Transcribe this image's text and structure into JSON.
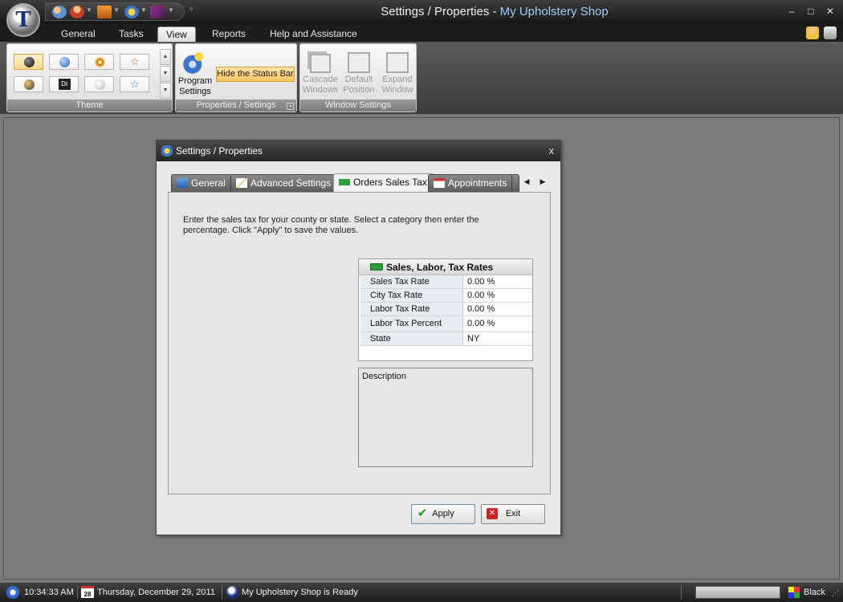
{
  "window": {
    "title": "Settings / Properties",
    "app_name": "My Upholstery Shop",
    "min_label": "–",
    "max_label": "□",
    "close_label": "✕"
  },
  "ribbon_tabs": [
    "General",
    "Tasks",
    "View",
    "Reports",
    "Help and Assistance"
  ],
  "ribbon": {
    "theme_group_label": "Theme",
    "program_settings_label": "Program Settings",
    "hide_status_bar_label": "Hide the Status Bar",
    "properties_group_label": "Properties / Settings",
    "cascade_label": "Cascade Windows",
    "default_position_label": "Default Position",
    "expand_label": "Expand Window",
    "window_group_label": "Window Settings",
    "theme_swatch_dr": "Dr"
  },
  "dialog": {
    "title": "Settings / Properties",
    "close_label": "x",
    "tabs": [
      "General",
      "Advanced Settings",
      "Orders Sales Tax",
      "Appointments"
    ],
    "instructions": "Enter the sales tax for your county or state. Select a category then enter the percentage. Click \"Apply\" to save the values.",
    "grid": {
      "category": "Sales, Labor, Tax Rates",
      "rows": [
        {
          "name": "Sales Tax Rate",
          "value": "0.00 %"
        },
        {
          "name": "City Tax Rate",
          "value": "0.00 %"
        },
        {
          "name": "Labor Tax Rate",
          "value": "0.00 %"
        },
        {
          "name": "Labor Tax Percent",
          "value": "0.00 %"
        },
        {
          "name": "State",
          "value": "NY"
        }
      ]
    },
    "description_label": "Description",
    "apply_label": "Apply",
    "exit_label": "Exit"
  },
  "statusbar": {
    "time": "10:34:33 AM",
    "calendar_day": "28",
    "date": "Thursday, December 29, 2011",
    "status": "My Upholstery Shop is Ready",
    "theme": "Black"
  },
  "colors": {
    "accent": "#9ecbf5",
    "selected_button": "#f9c45e"
  }
}
